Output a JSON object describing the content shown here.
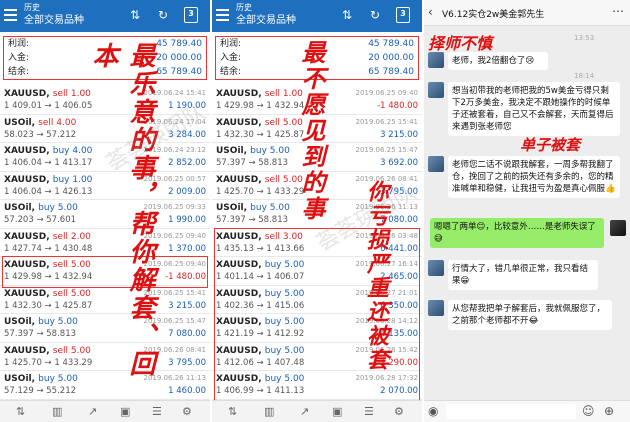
{
  "left": {
    "title": "历史",
    "subtitle": "全部交易品种",
    "calendar": "3",
    "summary": [
      {
        "label": "利润:",
        "value": "45 789.40"
      },
      {
        "label": "入金:",
        "value": "20 000.00"
      },
      {
        "label": "结余:",
        "value": "65 789.40"
      }
    ],
    "trades": [
      {
        "sym": "XAUUSD,",
        "side": "sell 1.00",
        "type": "sell",
        "px": "1 409.01 → 1 406.05",
        "dt": "2019.06.24 15:41",
        "pl": "1 190.00",
        "plc": "pos"
      },
      {
        "sym": "USOil,",
        "side": "sell 4.00",
        "type": "sell",
        "px": "58.023 → 57.212",
        "dt": "2019.06.24 17:04",
        "pl": "3 284.00",
        "plc": "pos"
      },
      {
        "sym": "XAUUSD,",
        "side": "buy 4.00",
        "type": "buy",
        "px": "1 406.04 → 1 413.17",
        "dt": "2019.06.24 23:12",
        "pl": "2 852.00",
        "plc": "pos"
      },
      {
        "sym": "XAUUSD,",
        "side": "buy 1.00",
        "type": "buy",
        "px": "1 406.04 → 1 426.13",
        "dt": "2019.06.25 00:57",
        "pl": "2 009.00",
        "plc": "pos"
      },
      {
        "sym": "USOil,",
        "side": "buy 5.00",
        "type": "buy",
        "px": "57.203 → 57.601",
        "dt": "2019.06.25 09:33",
        "pl": "1 990.00",
        "plc": "pos"
      },
      {
        "sym": "XAUUSD,",
        "side": "sell 2.00",
        "type": "sell",
        "px": "1 427.74 → 1 430.48",
        "dt": "2019.06.25 09:40",
        "pl": "1 370.00",
        "plc": "pos"
      },
      {
        "sym": "XAUUSD,",
        "side": "sell 5.00",
        "type": "sell",
        "px": "1 429.98 → 1 432.94",
        "dt": "2019.06.25 09:40",
        "pl": "-1 480.00",
        "plc": "neg"
      },
      {
        "sym": "XAUUSD,",
        "side": "sell 5.00",
        "type": "sell",
        "px": "1 432.30 → 1 425.87",
        "dt": "2019.06.25 15:41",
        "pl": "3 215.00",
        "plc": "pos"
      },
      {
        "sym": "USOil,",
        "side": "buy 5.00",
        "type": "buy",
        "px": "57.397 → 58.813",
        "dt": "2019.06.25 15:47",
        "pl": "7 080.00",
        "plc": "pos"
      },
      {
        "sym": "XAUUSD,",
        "side": "sell 5.00",
        "type": "sell",
        "px": "1 425.70 → 1 433.29",
        "dt": "2019.06.26 08:41",
        "pl": "3 795.00",
        "plc": "pos"
      },
      {
        "sym": "USOil,",
        "side": "buy 5.00",
        "type": "buy",
        "px": "57.129 → 55.212",
        "dt": "2019.06.26 11:13",
        "pl": "1 460.00",
        "plc": "pos"
      }
    ]
  },
  "right": {
    "title": "历史",
    "subtitle": "全部交易品种",
    "calendar": "3",
    "summary": [
      {
        "label": "利润:",
        "value": "45 789.40"
      },
      {
        "label": "入金:",
        "value": "20 000.00"
      },
      {
        "label": "结余:",
        "value": "65 789.40"
      }
    ],
    "trades": [
      {
        "sym": "XAUUSD,",
        "side": "sell 1.00",
        "type": "sell",
        "px": "1 429.98 → 1 432.94",
        "dt": "2019.06.25 09:40",
        "pl": "-1 480.00",
        "plc": "neg"
      },
      {
        "sym": "XAUUSD,",
        "side": "sell 5.00",
        "type": "sell",
        "px": "1 432.30 → 1 425.87",
        "dt": "2019.06.25 15:41",
        "pl": "3 215.00",
        "plc": "pos"
      },
      {
        "sym": "USOil,",
        "side": "buy 5.00",
        "type": "buy",
        "px": "57.397 → 58.813",
        "dt": "2019.06.25 15:47",
        "pl": "3 692.00",
        "plc": "pos"
      },
      {
        "sym": "XAUUSD,",
        "side": "sell 5.00",
        "type": "sell",
        "px": "1 425.70 → 1 433.29",
        "dt": "2019.06.26 08:41",
        "pl": "3 795.00",
        "plc": "pos"
      },
      {
        "sym": "USOil,",
        "side": "buy 5.00",
        "type": "buy",
        "px": "57.397 → 58.813",
        "dt": "2019.06.26 11:13",
        "pl": "7 080.00",
        "plc": "pos"
      },
      {
        "sym": "XAUUSD,",
        "side": "sell 3.00",
        "type": "sell",
        "px": "1 435.13 → 1 413.66",
        "dt": "2019.06.26 03:48",
        "pl": "6 441.00",
        "plc": "pos"
      },
      {
        "sym": "XAUUSD,",
        "side": "buy 5.00",
        "type": "buy",
        "px": "1 401.14 → 1 406.07",
        "dt": "2019.06.27 16:14",
        "pl": "2 465.00",
        "plc": "pos"
      },
      {
        "sym": "XAUUSD,",
        "side": "buy 5.00",
        "type": "buy",
        "px": "1 402.36 → 1 415.06",
        "dt": "2019.06.27 21:01",
        "pl": "6 350.00",
        "plc": "pos"
      },
      {
        "sym": "XAUUSD,",
        "side": "buy 5.00",
        "type": "buy",
        "px": "1 421.19 → 1 412.92",
        "dt": "2019.06.28 14:12",
        "pl": "4 135.00",
        "plc": "pos"
      },
      {
        "sym": "XAUUSD,",
        "side": "buy 5.00",
        "type": "buy",
        "px": "1 412.06 → 1 407.48",
        "dt": "2019.06.28 15:42",
        "pl": "-2 290.00",
        "plc": "neg"
      },
      {
        "sym": "XAUUSD,",
        "side": "buy 5.00",
        "type": "buy",
        "px": "1 406.99 → 1 411.13",
        "dt": "2019.06.28 17:32",
        "pl": "2 070.00",
        "plc": "pos"
      }
    ]
  },
  "annotations": {
    "left": "最乐意的事，帮你解套、回本",
    "right1": "最不愿见到的事",
    "right2": "你亏损严重还被套"
  },
  "watermark": "荟荟瑛团队",
  "chat": {
    "title": "V6.12实仓2w美金郭先生",
    "time1": "13:53",
    "time2": "18:14",
    "annot_top": "择师不慎",
    "annot_mid": "单子被套",
    "messages": [
      {
        "from": "other",
        "text": "老师，我2倍翻仓了😢"
      },
      {
        "from": "other",
        "text": "想当初带我的老师把我的5w美金亏得只剩下2万多美金，我决定不跟她操作的时候单子还被套着，自己又不会解套，天而复得后来遇到张老师您"
      },
      {
        "from": "other",
        "text": "老师您二话不说跟我解套，一周多帮我翻了仓，挽回了之前的损失还有多余的，您的精准喊单和稳健，让我扭亏为盈是真心佩服👍"
      },
      {
        "from": "me",
        "text": "嗯嗯了两单😊，比较意外……是老师失误了😅"
      },
      {
        "from": "other",
        "text": "行情大了，错几单很正常，我只看结果😁"
      },
      {
        "from": "other",
        "text": "从您帮我把单子解套后，我就佩服您了，之前那个老师都不开😂"
      }
    ]
  }
}
